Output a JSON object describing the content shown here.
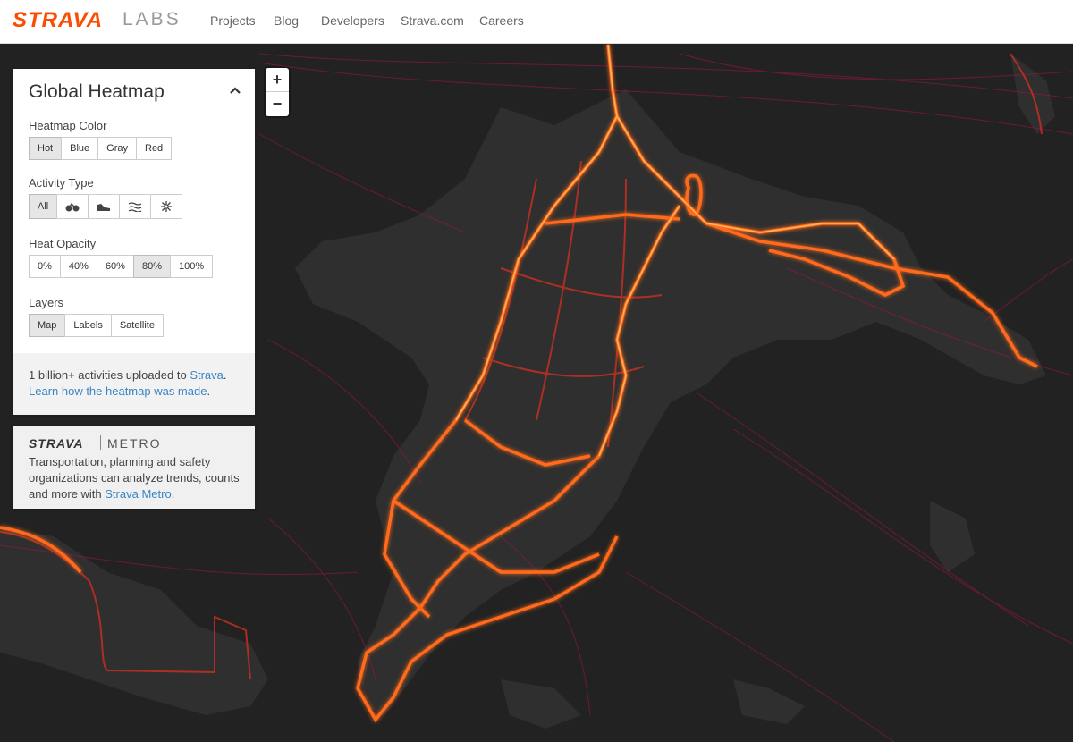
{
  "header": {
    "brand": "STRAVA",
    "labs": "LABS",
    "nav": [
      "Projects",
      "Blog",
      "Developers",
      "Strava.com",
      "Careers"
    ]
  },
  "zoom": {
    "in": "+",
    "out": "−"
  },
  "panel": {
    "title": "Global Heatmap",
    "heatmap_color": {
      "label": "Heatmap Color",
      "options": [
        "Hot",
        "Blue",
        "Gray",
        "Red"
      ],
      "selected": "Hot"
    },
    "activity_type": {
      "label": "Activity Type",
      "selected": "All",
      "options": [
        {
          "label": "All",
          "icon": null
        },
        {
          "label": "",
          "icon": "bike-icon"
        },
        {
          "label": "",
          "icon": "shoe-icon"
        },
        {
          "label": "",
          "icon": "water-icon"
        },
        {
          "label": "",
          "icon": "snowflake-icon"
        }
      ]
    },
    "heat_opacity": {
      "label": "Heat Opacity",
      "options": [
        "0%",
        "40%",
        "60%",
        "80%",
        "100%"
      ],
      "selected": "80%"
    },
    "layers": {
      "label": "Layers",
      "options": [
        "Map",
        "Labels",
        "Satellite"
      ],
      "selected": "Map"
    },
    "info": {
      "line1_prefix": "1 billion+ activities uploaded to ",
      "line1_link": "Strava",
      "line1_suffix": ".",
      "line2_link": "Learn how the heatmap was made",
      "line2_suffix": "."
    }
  },
  "metro": {
    "brand": "STRAVA",
    "word": "METRO",
    "text": "Transportation, planning and safety organizations can analyze trends, counts and more with ",
    "link": "Strava Metro",
    "suffix": "."
  },
  "colors": {
    "brand": "#fc4c02",
    "link": "#3a85c5",
    "water": "#222222",
    "land": "#2e2e2e",
    "heat_hot": "#ffb040",
    "heat_mid": "#ff6a1a",
    "heat_low": "#a8124a"
  }
}
